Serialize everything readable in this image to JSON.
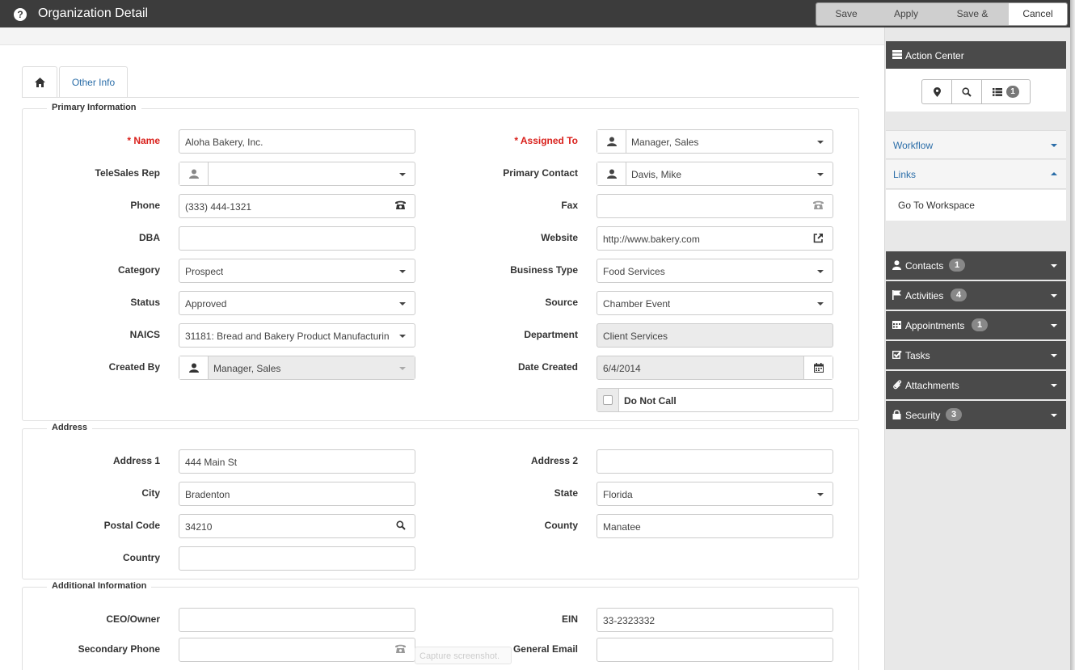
{
  "window": {
    "title": "Organization Detail",
    "buttons": {
      "save": "Save",
      "apply": "Apply",
      "save_new": "Save & New",
      "cancel": "Cancel"
    }
  },
  "tabs": {
    "other": "Other Info"
  },
  "primary": {
    "legend": "Primary Information",
    "name": {
      "label": "* Name",
      "value": "Aloha Bakery, Inc."
    },
    "assigned_to": {
      "label": "* Assigned To",
      "value": "Manager, Sales"
    },
    "telesales_rep": {
      "label": "TeleSales Rep",
      "value": ""
    },
    "primary_contact": {
      "label": "Primary Contact",
      "value": "Davis, Mike"
    },
    "phone": {
      "label": "Phone",
      "value": "(333) 444-1321"
    },
    "fax": {
      "label": "Fax",
      "value": ""
    },
    "dba": {
      "label": "DBA",
      "value": ""
    },
    "website": {
      "label": "Website",
      "value": "http://www.bakery.com"
    },
    "category": {
      "label": "Category",
      "value": "Prospect"
    },
    "business_type": {
      "label": "Business Type",
      "value": "Food Services"
    },
    "status": {
      "label": "Status",
      "value": "Approved"
    },
    "source": {
      "label": "Source",
      "value": "Chamber Event"
    },
    "naics": {
      "label": "NAICS",
      "value": "31181: Bread and Bakery Product Manufacturin"
    },
    "department": {
      "label": "Department",
      "value": "Client Services"
    },
    "created_by": {
      "label": "Created By",
      "value": "Manager, Sales"
    },
    "date_created": {
      "label": "Date Created",
      "value": "6/4/2014"
    },
    "do_not_call": {
      "label": "Do Not Call",
      "checked": false
    }
  },
  "address": {
    "legend": "Address",
    "address1": {
      "label": "Address 1",
      "value": "444 Main St"
    },
    "address2": {
      "label": "Address 2",
      "value": ""
    },
    "city": {
      "label": "City",
      "value": "Bradenton"
    },
    "state": {
      "label": "State",
      "value": "Florida"
    },
    "postal_code": {
      "label": "Postal Code",
      "value": "34210"
    },
    "county": {
      "label": "County",
      "value": "Manatee"
    },
    "country": {
      "label": "Country",
      "value": ""
    }
  },
  "additional": {
    "legend": "Additional Information",
    "ceo_owner": {
      "label": "CEO/Owner",
      "value": ""
    },
    "ein": {
      "label": "EIN",
      "value": "33-2323332"
    },
    "secondary_phone": {
      "label": "Secondary Phone",
      "value": ""
    },
    "general_email": {
      "label": "General Email",
      "value": ""
    }
  },
  "capture_hint": "Capture screenshot.",
  "side": {
    "action_center": "Action Center",
    "list_count": "1",
    "workflow": "Workflow",
    "links": "Links",
    "go_to_workspace": "Go To Workspace",
    "panels": [
      {
        "label": "Contacts",
        "badge": "1",
        "icon": "user-icon"
      },
      {
        "label": "Activities",
        "badge": "4",
        "icon": "flag-icon"
      },
      {
        "label": "Appointments",
        "badge": "1",
        "icon": "calendar-icon"
      },
      {
        "label": "Tasks",
        "badge": "",
        "icon": "check-square-icon"
      },
      {
        "label": "Attachments",
        "badge": "",
        "icon": "paperclip-icon"
      },
      {
        "label": "Security",
        "badge": "3",
        "icon": "lock-icon"
      }
    ]
  }
}
